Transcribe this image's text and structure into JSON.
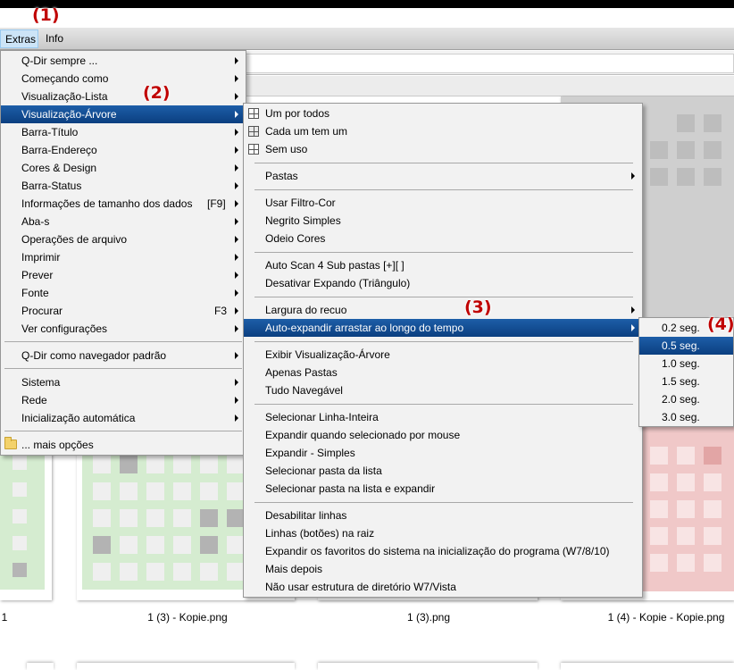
{
  "markers": {
    "m1": "(1)",
    "m2": "(2)",
    "m3": "(3)",
    "m4": "(4)"
  },
  "menubar": {
    "extras": "Extras",
    "info": "Info"
  },
  "menu_main": {
    "items": [
      {
        "label": "Q-Dir sempre ...",
        "submenu": true
      },
      {
        "label": "Começando como",
        "submenu": true
      },
      {
        "label": "Visualização-Lista",
        "submenu": true
      },
      {
        "label": "Visualização-Árvore",
        "submenu": true,
        "selected": true
      },
      {
        "label": "Barra-Título",
        "submenu": true
      },
      {
        "label": "Barra-Endereço",
        "submenu": true
      },
      {
        "label": "Cores & Design",
        "submenu": true
      },
      {
        "label": "Barra-Status",
        "submenu": true
      },
      {
        "label": "Informações de tamanho dos dados",
        "shortcut": "[F9]",
        "submenu": true
      },
      {
        "label": "Aba-s",
        "submenu": true
      },
      {
        "label": "Operações de arquivo",
        "submenu": true
      },
      {
        "label": "Imprimir",
        "submenu": true
      },
      {
        "label": "Prever",
        "submenu": true
      },
      {
        "label": "Fonte",
        "submenu": true
      },
      {
        "label": "Procurar",
        "shortcut": "F3",
        "submenu": true
      },
      {
        "label": "Ver configurações",
        "submenu": true
      },
      {
        "label": "Q-Dir como navegador padrão",
        "submenu": true
      },
      {
        "label": "Sistema",
        "submenu": true
      },
      {
        "label": "Rede",
        "submenu": true
      },
      {
        "label": "Inicialização automática",
        "submenu": true
      },
      {
        "label": "... mais opções",
        "submenu": false
      }
    ]
  },
  "menu_tree": {
    "items": [
      {
        "label": "Um por todos",
        "icon": "tree-icon"
      },
      {
        "label": "Cada um tem um",
        "icon": "tree-icon"
      },
      {
        "label": "Sem uso",
        "icon": "tree-icon"
      },
      {
        "label": "Pastas",
        "submenu": true
      },
      {
        "label": "Usar Filtro-Cor"
      },
      {
        "label": "Negrito Simples"
      },
      {
        "label": "Odeio Cores"
      },
      {
        "label": "Auto Scan 4 Sub pastas [+][ ]"
      },
      {
        "label": "Desativar Expando (Triângulo)"
      },
      {
        "label": "Largura do recuo",
        "submenu": true
      },
      {
        "label": "Auto-expandir arrastar ao longo do tempo",
        "submenu": true,
        "selected": true
      },
      {
        "label": "Exibir Visualização-Árvore"
      },
      {
        "label": "Apenas Pastas"
      },
      {
        "label": "Tudo Navegável"
      },
      {
        "label": "Selecionar Linha-Inteira"
      },
      {
        "label": "Expandir quando selecionado por mouse"
      },
      {
        "label": "Expandir - Simples"
      },
      {
        "label": "Selecionar pasta da lista"
      },
      {
        "label": "Selecionar pasta na lista e expandir"
      },
      {
        "label": "Desabilitar linhas"
      },
      {
        "label": "Linhas (botões) na raiz"
      },
      {
        "label": "Expandir os favoritos do sistema na inicialização do programa (W7/8/10)"
      },
      {
        "label": "Mais depois"
      },
      {
        "label": "Não usar estrutura de diretório W7/Vista"
      }
    ]
  },
  "menu_time": {
    "items": [
      {
        "label": "0.2 seg."
      },
      {
        "label": "0.5 seg.",
        "selected": true
      },
      {
        "label": "1.0 seg."
      },
      {
        "label": "1.5 seg."
      },
      {
        "label": "2.0 seg."
      },
      {
        "label": "3.0 seg."
      }
    ]
  },
  "thumbnails": {
    "labels": [
      "1 (3) - Kopie.png",
      "1 (3).png",
      "1 (4) - Kopie - Kopie.png"
    ]
  },
  "colors": {
    "selection": "#0b3f80",
    "marker": "#c00000",
    "grid_green": "#d5ecd0",
    "grid_red": "#f0c8c8"
  }
}
